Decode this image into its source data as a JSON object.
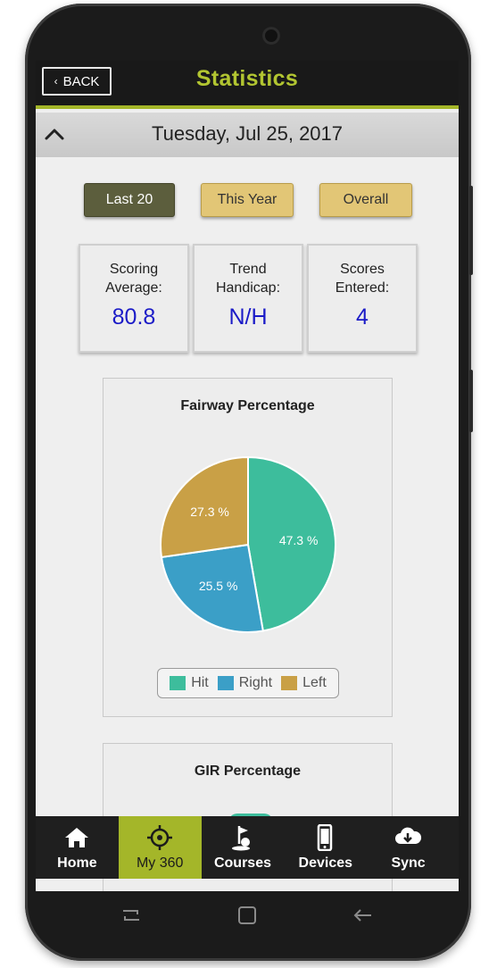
{
  "header": {
    "back_label": "BACK",
    "title": "Statistics"
  },
  "date_bar": {
    "date": "Tuesday, Jul 25, 2017"
  },
  "filters": [
    {
      "label": "Last 20",
      "active": true
    },
    {
      "label": "This Year",
      "active": false
    },
    {
      "label": "Overall",
      "active": false
    }
  ],
  "stats": [
    {
      "label": "Scoring Average:",
      "value": "80.8"
    },
    {
      "label": "Trend Handicap:",
      "value": "N/H"
    },
    {
      "label": "Scores Entered:",
      "value": "4"
    }
  ],
  "chart_data": [
    {
      "type": "pie",
      "title": "Fairway Percentage",
      "categories": [
        "Hit",
        "Right",
        "Left"
      ],
      "values": [
        47.3,
        25.5,
        27.3
      ],
      "labels": [
        "47.3 %",
        "25.5 %",
        "27.3 %"
      ],
      "colors": [
        "#3dbd9c",
        "#3b9fc7",
        "#c9a046"
      ],
      "legend": "bottom"
    },
    {
      "type": "pie",
      "title": "GIR Percentage"
    }
  ],
  "nav": [
    {
      "label": "Home",
      "icon": "home-icon"
    },
    {
      "label": "My 360",
      "icon": "crosshair-icon",
      "active": true
    },
    {
      "label": "Courses",
      "icon": "golf-flag-icon"
    },
    {
      "label": "Devices",
      "icon": "phone-icon"
    },
    {
      "label": "Sync",
      "icon": "cloud-download-icon"
    }
  ],
  "colors": {
    "accent": "#a4b629",
    "title": "#b2c531",
    "stat_value": "#1b1bc7",
    "filter_active": "#5c5e3d",
    "filter_idle": "#e2c676"
  }
}
